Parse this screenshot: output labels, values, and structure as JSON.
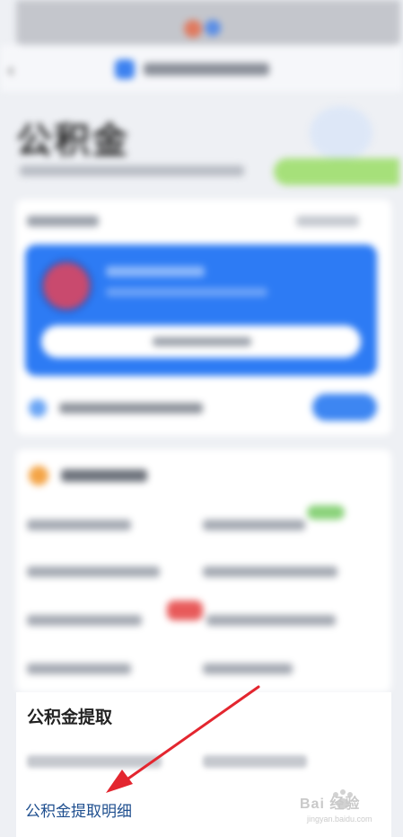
{
  "page": {
    "hero_title": "公积金",
    "section_title": "公积金提取",
    "highlight_link": "公积金提取明细"
  },
  "watermark": {
    "brand": "Bai 经验",
    "url": "jingyan.baidu.com"
  },
  "colors": {
    "accent_blue": "#2d7bf4",
    "annotation_arrow": "#e3262f",
    "link": "#1f4f8f"
  },
  "icons": [
    "back-arrow-icon",
    "service-icon",
    "avatar",
    "notice-icon",
    "service-group-icon",
    "annotation-arrow"
  ]
}
